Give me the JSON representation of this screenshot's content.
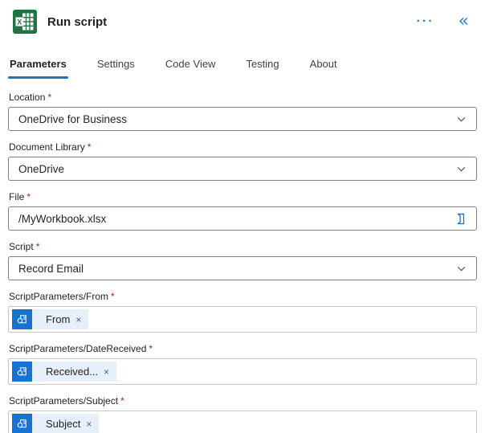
{
  "header": {
    "title": "Run script",
    "app_icon": "excel-icon",
    "more_glyph": "···",
    "collapse_glyph": "«"
  },
  "tabs": [
    {
      "label": "Parameters",
      "active": true
    },
    {
      "label": "Settings",
      "active": false
    },
    {
      "label": "Code View",
      "active": false
    },
    {
      "label": "Testing",
      "active": false
    },
    {
      "label": "About",
      "active": false
    }
  ],
  "required_marker": "*",
  "token_remove_glyph": "×",
  "fields": [
    {
      "type": "dropdown",
      "label": "Location",
      "required": true,
      "value": "OneDrive for Business"
    },
    {
      "type": "dropdown",
      "label": "Document Library",
      "required": true,
      "value": "OneDrive"
    },
    {
      "type": "text",
      "label": "File",
      "required": true,
      "value": "/MyWorkbook.xlsx",
      "trailing_icon": "file-picker-icon"
    },
    {
      "type": "dropdown",
      "label": "Script",
      "required": true,
      "value": "Record Email"
    },
    {
      "type": "token",
      "label": "ScriptParameters/From",
      "required": true,
      "token": {
        "text": "From",
        "icon": "outlook-icon"
      }
    },
    {
      "type": "token",
      "label": "ScriptParameters/DateReceived",
      "required": true,
      "token": {
        "text": "Received...",
        "icon": "outlook-icon"
      }
    },
    {
      "type": "token",
      "label": "ScriptParameters/Subject",
      "required": true,
      "token": {
        "text": "Subject",
        "icon": "outlook-icon"
      }
    }
  ],
  "colors": {
    "accent_blue": "#1878be",
    "excel_green": "#217346",
    "required_red": "#a4262c",
    "token_icon_bg": "#1673d1",
    "token_body_bg": "#e7f0fa",
    "dropdown_border": "#7f7f7f",
    "token_field_border": "#c6c6c6"
  }
}
